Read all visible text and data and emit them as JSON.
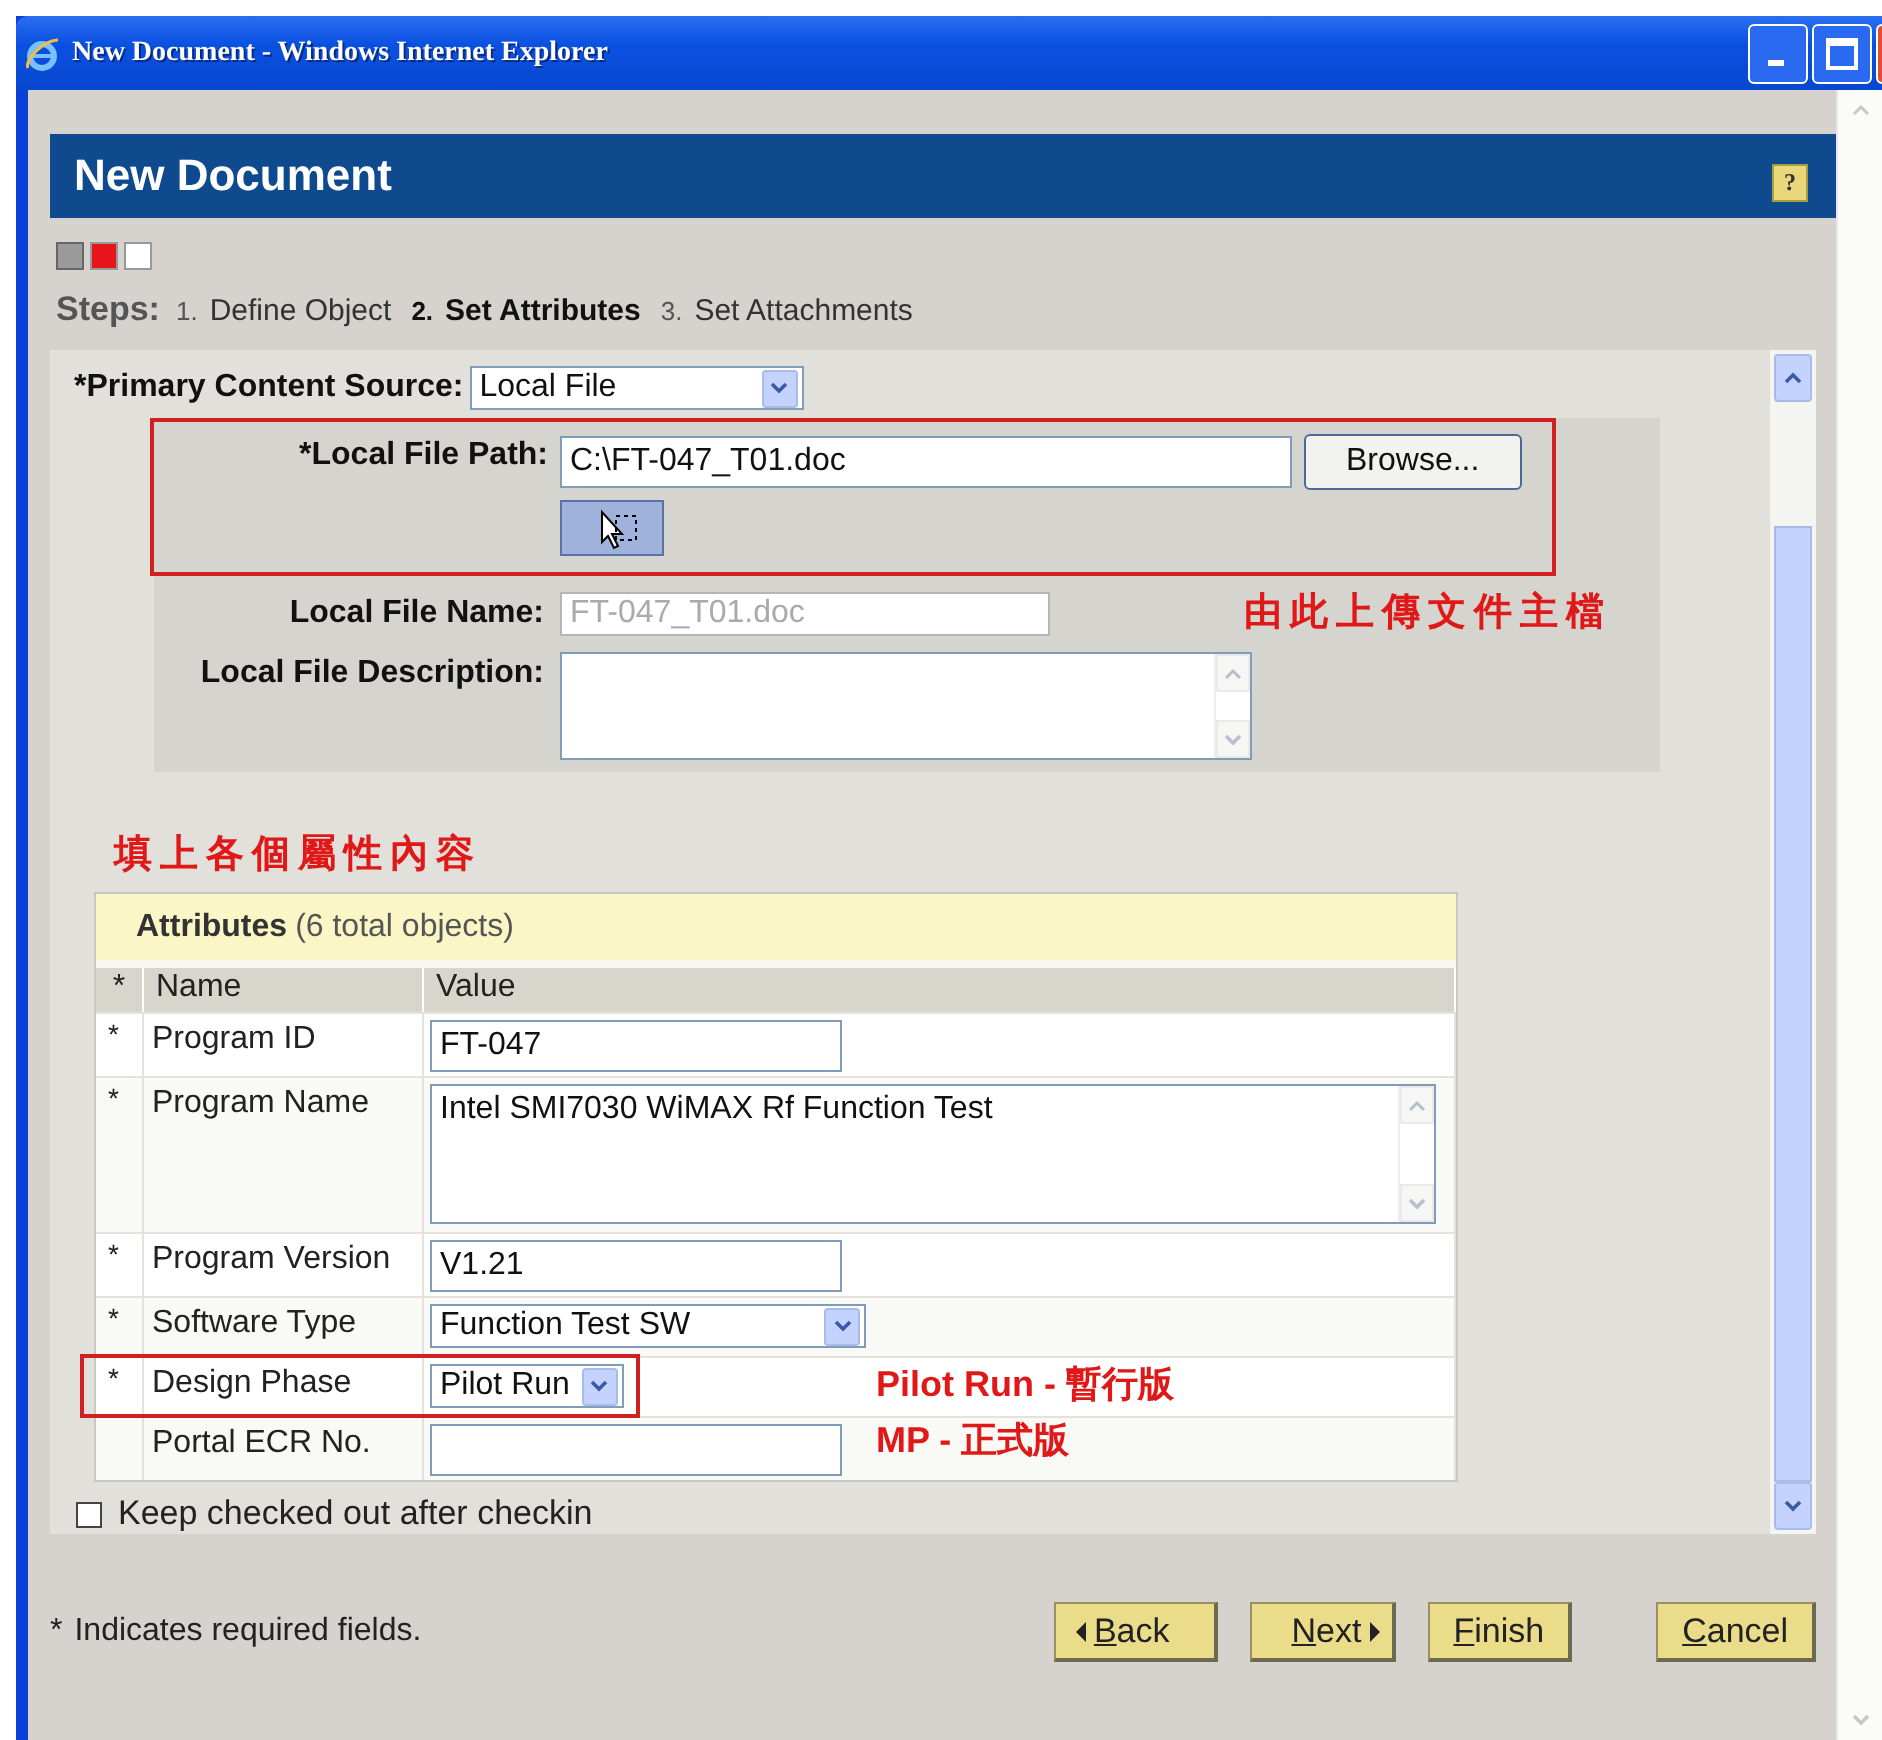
{
  "window": {
    "title": "New Document - Windows Internet Explorer"
  },
  "header": {
    "title": "New Document",
    "help": "?"
  },
  "progress": [
    {
      "completed": true,
      "selected": false
    },
    {
      "completed": false,
      "selected": true
    },
    {
      "completed": false,
      "selected": false
    }
  ],
  "steps": {
    "label": "Steps:",
    "items": [
      {
        "number": "1.",
        "label": "Define Object",
        "selected": false
      },
      {
        "number": "2.",
        "label": "Set Attributes",
        "selected": true
      },
      {
        "number": "3.",
        "label": "Set Attachments",
        "selected": false
      }
    ]
  },
  "primary_source": {
    "label": "*Primary Content Source:",
    "value": "Local File"
  },
  "local_file": {
    "highlighted": true,
    "path_label": "*Local File Path:",
    "path": "C:\\FT-047_T01.doc",
    "browse": "Browse...",
    "name_label": "Local File Name:",
    "name": "FT-047_T01.doc",
    "name_disabled": true,
    "description_label": "Local File Description:"
  },
  "annotations": {
    "upload_note": "由此上傳文件主檔",
    "attributes_note": "填上各個屬性內容",
    "phase_notes": [
      "Pilot Run - 暫行版",
      "MP - 正式版"
    ]
  },
  "attributes": {
    "title": "Attributes",
    "count": "(6 total objects)",
    "columns": [
      "*",
      "Name",
      "Value"
    ],
    "rows": [
      {
        "mark": "*",
        "name": "Program ID",
        "kind": "text",
        "value": "FT-047",
        "highlighted": false
      },
      {
        "mark": "*",
        "name": "Program Name",
        "kind": "textarea",
        "value": "Intel SMI7030 WiMAX Rf Function Test",
        "highlighted": false
      },
      {
        "mark": "*",
        "name": "Program Version",
        "kind": "text",
        "value": "V1.21",
        "highlighted": false
      },
      {
        "mark": "*",
        "name": "Software Type",
        "kind": "select",
        "value": "Function Test SW",
        "highlighted": false
      },
      {
        "mark": "*",
        "name": "Design Phase",
        "kind": "select",
        "value": "Pilot Run",
        "highlighted": true
      },
      {
        "name": "Portal ECR No.",
        "kind": "text",
        "highlighted": false
      }
    ]
  },
  "keep_checked_out": {
    "label": "Keep checked out after checkin",
    "checked": false
  },
  "footer": {
    "note_mark": "*",
    "note": "Indicates required fields.",
    "buttons": [
      {
        "label": "Back",
        "kind": "back"
      },
      {
        "label": "Next",
        "kind": "next"
      },
      {
        "label": "Finish",
        "kind": "plain"
      },
      {
        "label": "Cancel",
        "kind": "plain"
      }
    ]
  }
}
